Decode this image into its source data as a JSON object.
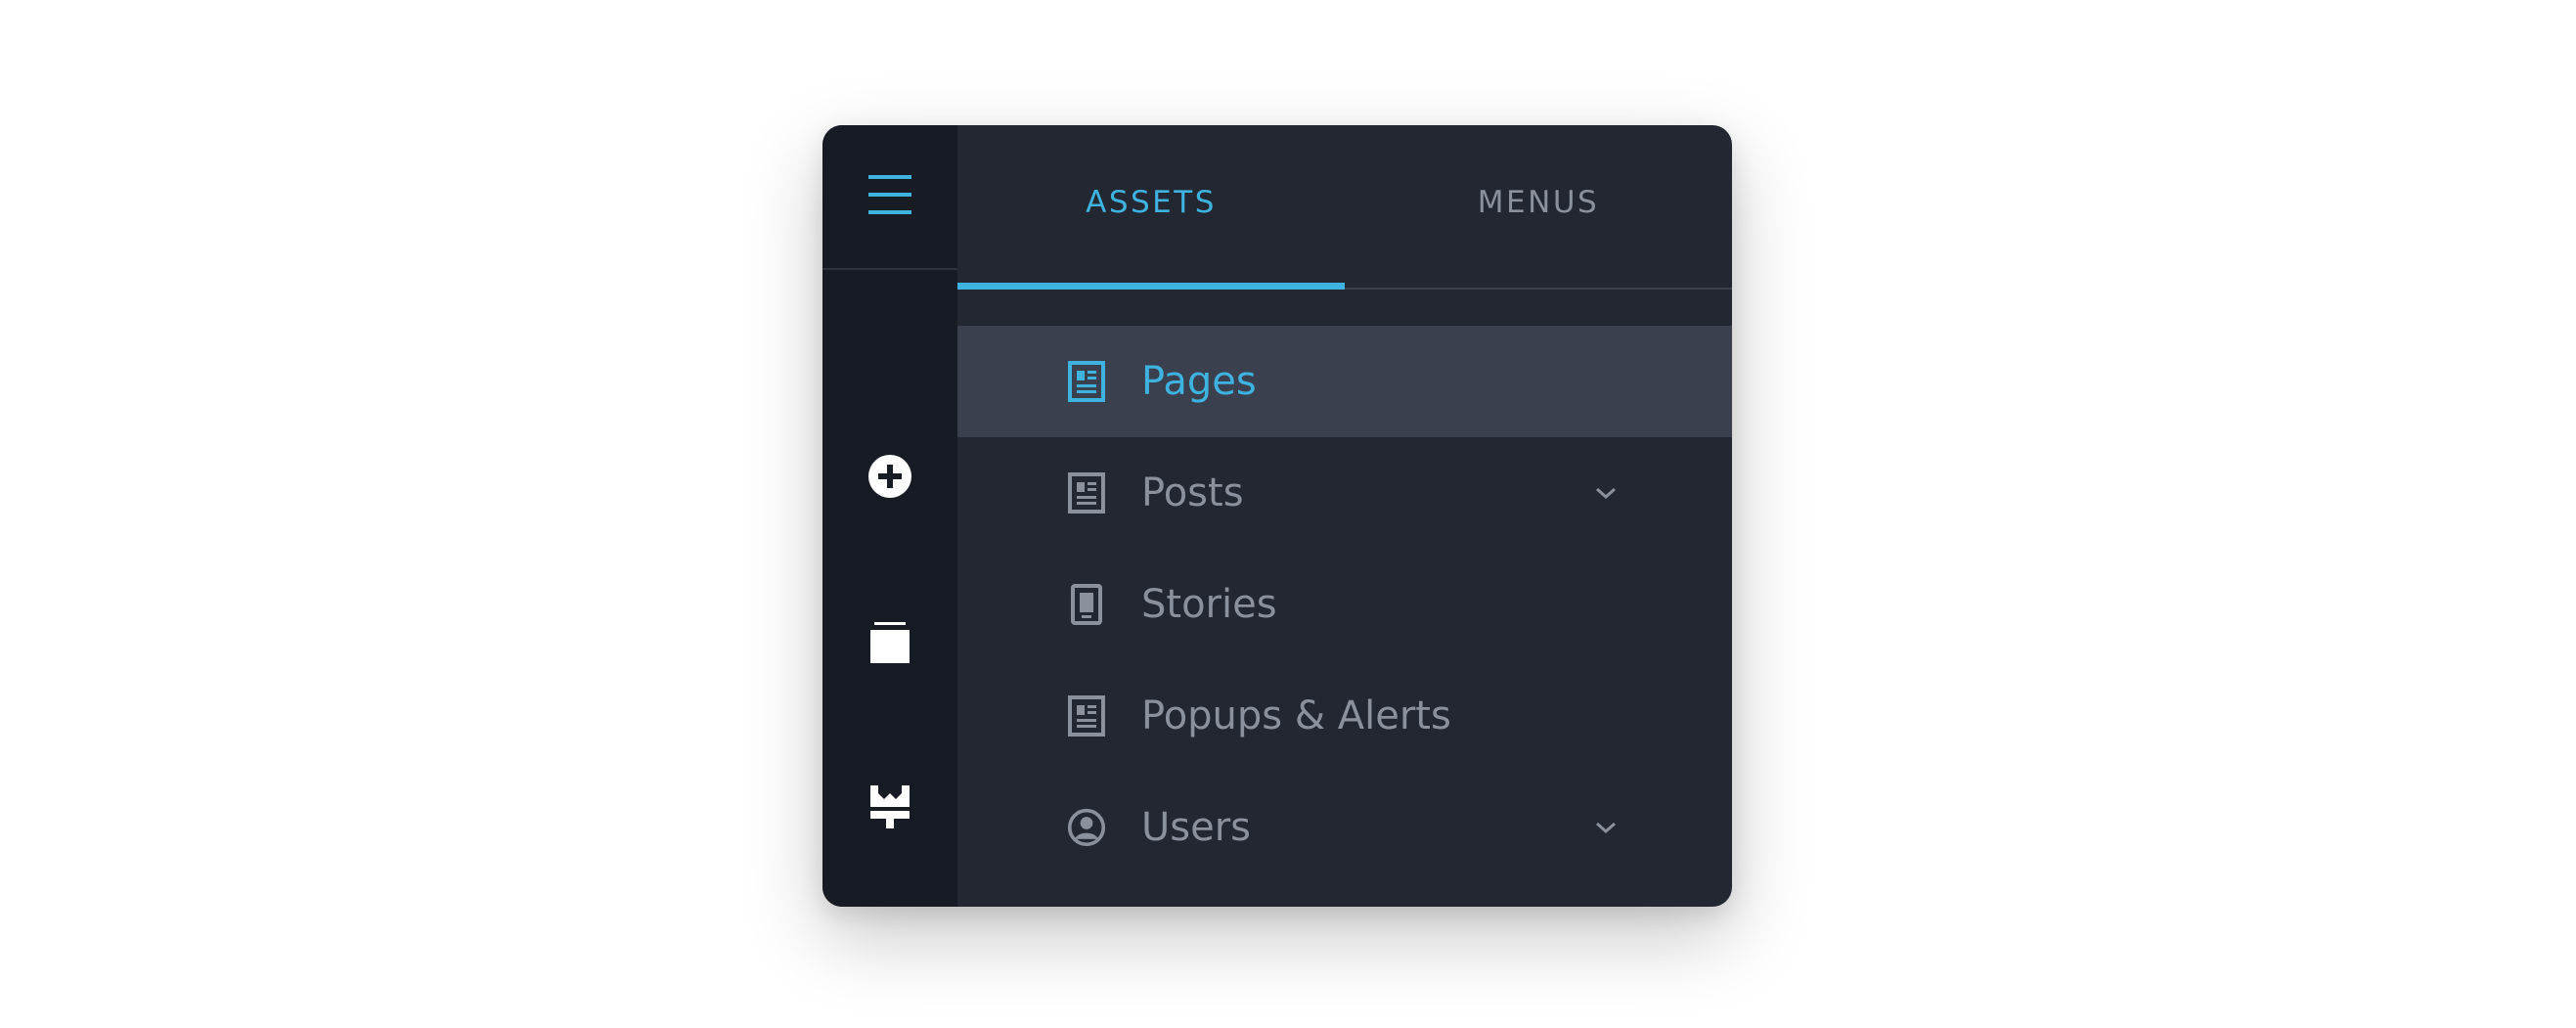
{
  "tabs": [
    {
      "label": "ASSETS",
      "active": true
    },
    {
      "label": "MENUS",
      "active": false
    }
  ],
  "rail": {
    "menu_icon": "hamburger-icon",
    "buttons": [
      {
        "icon": "add-circle-icon"
      },
      {
        "icon": "folder-icon"
      },
      {
        "icon": "paint-brush-icon"
      }
    ]
  },
  "menu": {
    "items": [
      {
        "label": "Pages",
        "icon": "document-icon",
        "active": true,
        "expandable": false
      },
      {
        "label": "Posts",
        "icon": "document-icon",
        "active": false,
        "expandable": true
      },
      {
        "label": "Stories",
        "icon": "mobile-icon",
        "active": false,
        "expandable": false
      },
      {
        "label": "Popups & Alerts",
        "icon": "document-icon",
        "active": false,
        "expandable": false
      },
      {
        "label": "Users",
        "icon": "user-circle-icon",
        "active": false,
        "expandable": true
      }
    ]
  },
  "colors": {
    "accent": "#3fb3e0",
    "rail_bg": "#171b23",
    "panel_bg": "#222732",
    "active_row_bg": "#3a404d",
    "muted_text": "#8a909c"
  }
}
